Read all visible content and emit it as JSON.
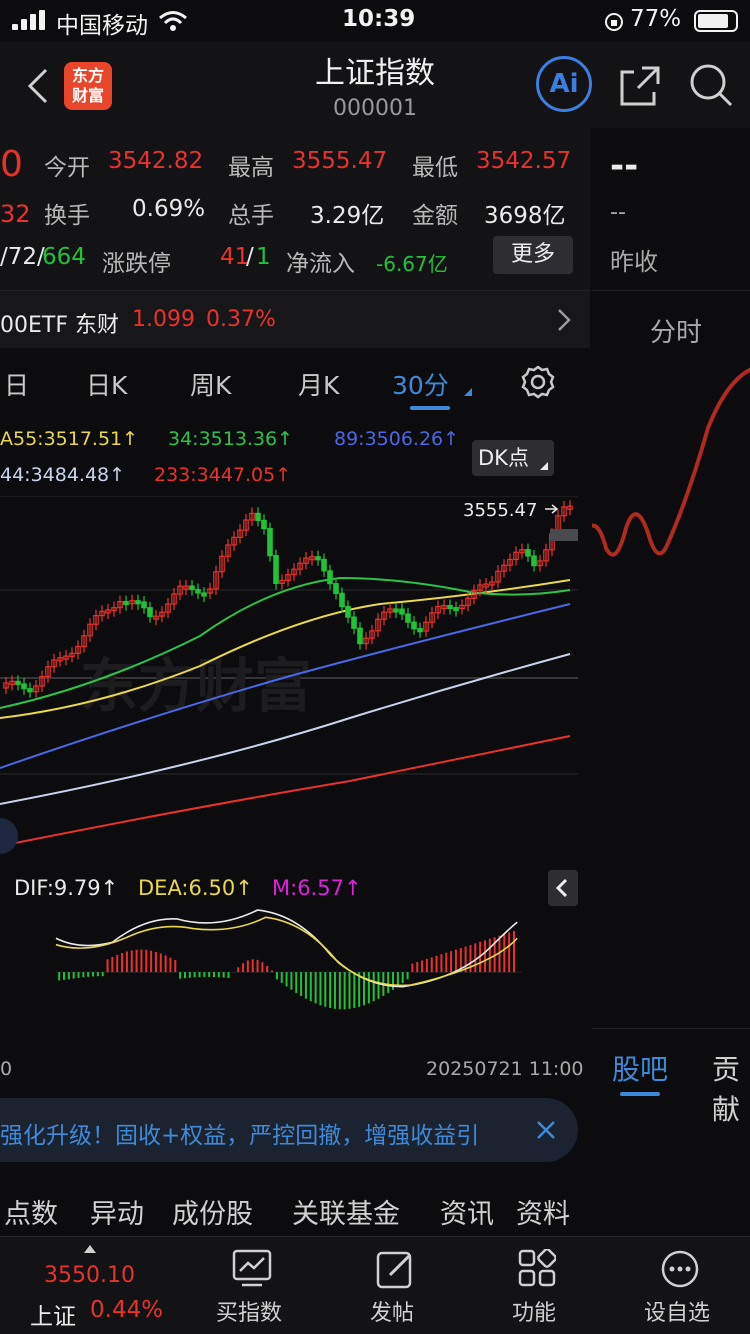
{
  "status_bar": {
    "carrier": "中国移动",
    "time": "10:39",
    "battery": "77%"
  },
  "header": {
    "logo_text_1": "东方",
    "logo_text_2": "财富",
    "title": "上证指数",
    "code": "000001",
    "ai_label": "Ai"
  },
  "quote": {
    "price_partial": "0",
    "change_partial": "32",
    "open_label": "今开",
    "open": "3542.82",
    "high_label": "最高",
    "high": "3555.47",
    "low_label": "最低",
    "low": "3542.57",
    "turnover_label": "换手",
    "turnover": "0.69%",
    "volume_label": "总手",
    "volume": "3.29亿",
    "amount_label": "金额",
    "amount": "3698亿",
    "breadth_prefix": "/72/",
    "breadth_down": "664",
    "limit_label": "涨跌停",
    "limit_up": "41",
    "limit_sep": "/",
    "limit_down": "1",
    "netflow_label": "净流入",
    "netflow": "-6.67亿",
    "more_label": "更多"
  },
  "etf": {
    "name": "00ETF 东财",
    "price": "1.099",
    "change": "0.37%"
  },
  "right_panel": {
    "dash_top": "--",
    "dash_mid": "--",
    "prev_close_label": "昨收",
    "intraday_label": "分时",
    "tab_guba": "股吧",
    "tab_contrib": "贡献"
  },
  "period_tabs": {
    "t1": "日",
    "t2": "日K",
    "t3": "周K",
    "t4": "月K",
    "t5": "30分"
  },
  "indicators": {
    "ma1": "A55:3517.51↑",
    "ma2": "34:3513.36↑",
    "ma3": "89:3506.26↑",
    "ma4": "44:3484.48↑",
    "ma5": "233:3447.05↑",
    "dk_label": "DK点"
  },
  "chart": {
    "high_marker": "3555.47",
    "watermark": "东方财富"
  },
  "macd": {
    "dif": "DIF:9.79↑",
    "dea": "DEA:6.50↑",
    "m": "M:6.57↑",
    "date_left": "0",
    "date_right": "20250721 11:00"
  },
  "promo": {
    "text": "强化升级！固收+权益，严控回撤，增强收益引"
  },
  "bottom_tabs": {
    "t1": "点数",
    "t2": "异动",
    "t3": "成份股",
    "t4": "关联基金",
    "t5": "资讯",
    "t6": "资料"
  },
  "toolbar": {
    "index_price": "3550.10",
    "index_name": "上证",
    "index_change": "0.44%",
    "buy_label": "买指数",
    "post_label": "发帖",
    "func_label": "功能",
    "fav_label": "设自选"
  },
  "colors": {
    "up": "#e8322c",
    "down": "#21c23a",
    "accent": "#3f8ad8",
    "bg": "#0c0c0e"
  }
}
